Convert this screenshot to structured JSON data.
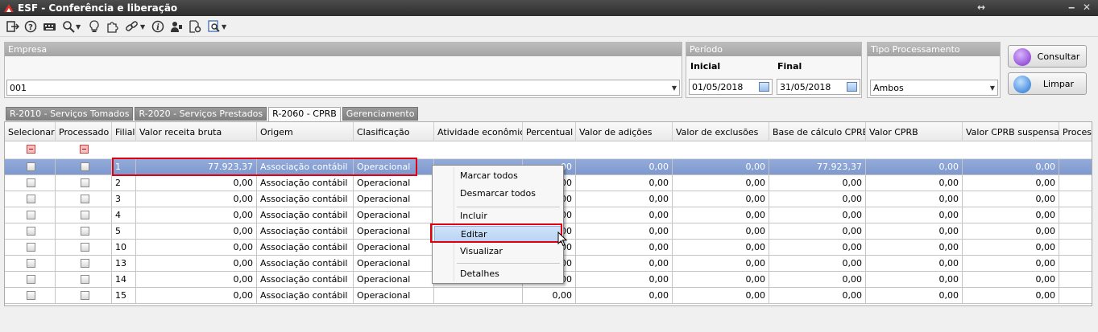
{
  "window": {
    "title": "ESF - Conferência e liberação",
    "restore_icon": "↔",
    "minimize_icon": "‒",
    "close_icon": "✕"
  },
  "toolbar": {
    "icons": [
      "exit-icon",
      "help-icon",
      "keyboard-icon",
      "zoom-icon",
      "lightbulb-icon",
      "puzzle-icon",
      "link-icon",
      "info-icon",
      "user-icon",
      "page-settings-icon",
      "report-icon"
    ]
  },
  "empresa": {
    "label": "Empresa",
    "value": "001"
  },
  "periodo": {
    "label": "Período",
    "inicial_label": "Inicial",
    "final_label": "Final",
    "inicial": "01/05/2018",
    "final": "31/05/2018"
  },
  "tipo": {
    "label": "Tipo Processamento",
    "value": "Ambos"
  },
  "buttons": {
    "consultar": "Consultar",
    "limpar": "Limpar"
  },
  "tabs": [
    "R-2010 - Serviços Tomados",
    "R-2020 - Serviços Prestados",
    "R-2060 - CPRB",
    "Gerenciamento"
  ],
  "columns": [
    "Selecionar",
    "Processado",
    "Filial",
    "Valor receita bruta",
    "Origem",
    "Clasificação",
    "Atividade econômica",
    "Percentual",
    "Valor de adições",
    "Valor de exclusões",
    "Base de cálculo CPRB",
    "Valor CPRB",
    "Valor CPRB suspensa",
    "Proces"
  ],
  "rows": [
    {
      "filial": "1",
      "receita": "77.923,37",
      "origem": "Associação contábil",
      "clas": "Operacional",
      "perc": ",00",
      "adicoes": "0,00",
      "exclusoes": "0,00",
      "base": "77.923,37",
      "cprb": "0,00",
      "suspensa": "0,00"
    },
    {
      "filial": "2",
      "receita": "0,00",
      "origem": "Associação contábil",
      "clas": "Operacional",
      "perc": "00",
      "adicoes": "0,00",
      "exclusoes": "0,00",
      "base": "0,00",
      "cprb": "0,00",
      "suspensa": "0,00"
    },
    {
      "filial": "3",
      "receita": "0,00",
      "origem": "Associação contábil",
      "clas": "Operacional",
      "perc": "00",
      "adicoes": "0,00",
      "exclusoes": "0,00",
      "base": "0,00",
      "cprb": "0,00",
      "suspensa": "0,00"
    },
    {
      "filial": "4",
      "receita": "0,00",
      "origem": "Associação contábil",
      "clas": "Operacional",
      "perc": "00",
      "adicoes": "0,00",
      "exclusoes": "0,00",
      "base": "0,00",
      "cprb": "0,00",
      "suspensa": "0,00"
    },
    {
      "filial": "5",
      "receita": "0,00",
      "origem": "Associação contábil",
      "clas": "Operacional",
      "perc": "00",
      "adicoes": "0,00",
      "exclusoes": "0,00",
      "base": "0,00",
      "cprb": "0,00",
      "suspensa": "0,00"
    },
    {
      "filial": "10",
      "receita": "0,00",
      "origem": "Associação contábil",
      "clas": "Operacional",
      "perc": "00",
      "adicoes": "0,00",
      "exclusoes": "0,00",
      "base": "0,00",
      "cprb": "0,00",
      "suspensa": "0,00"
    },
    {
      "filial": "13",
      "receita": "0,00",
      "origem": "Associação contábil",
      "clas": "Operacional",
      "perc": "00",
      "adicoes": "0,00",
      "exclusoes": "0,00",
      "base": "0,00",
      "cprb": "0,00",
      "suspensa": "0,00"
    },
    {
      "filial": "14",
      "receita": "0,00",
      "origem": "Associação contábil",
      "clas": "Operacional",
      "perc": "00",
      "adicoes": "0,00",
      "exclusoes": "0,00",
      "base": "0,00",
      "cprb": "0,00",
      "suspensa": "0,00"
    },
    {
      "filial": "15",
      "receita": "0,00",
      "origem": "Associação contábil",
      "clas": "Operacional",
      "perc": "0,00",
      "adicoes": "0,00",
      "exclusoes": "0,00",
      "base": "0,00",
      "cprb": "0,00",
      "suspensa": "0,00"
    }
  ],
  "context_menu": [
    "Marcar todos",
    "Desmarcar todos",
    "Incluir",
    "Editar",
    "Visualizar",
    "Detalhes"
  ],
  "colors": {
    "selected_row": "#8aa3d6",
    "highlight": "#e00010",
    "menu_hover": "#c5dbf7"
  }
}
